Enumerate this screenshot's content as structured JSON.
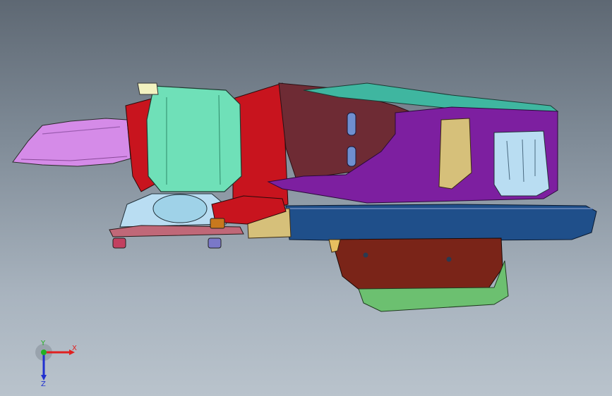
{
  "viewport": {
    "triad": {
      "x_label": "X",
      "y_label": "Y",
      "z_label": "Z",
      "x_color": "#e02020",
      "y_color": "#22b022",
      "z_color": "#2030d0"
    }
  },
  "model": {
    "part_colors": {
      "left_arm": "#d58be8",
      "mount_housing": "#6fe0b8",
      "frame_red": "#c8141e",
      "dark_body": "#6e2b34",
      "purple_rail": "#7d1fa0",
      "tan_plate": "#d6c07a",
      "blue_pan": "#1f4f8a",
      "brown_pan": "#7a2418",
      "green_tray": "#6cc070",
      "light_blue_bracket": "#b9ddf2",
      "teal_top": "#3fb6a0",
      "orange_nut": "#c8781e"
    }
  }
}
